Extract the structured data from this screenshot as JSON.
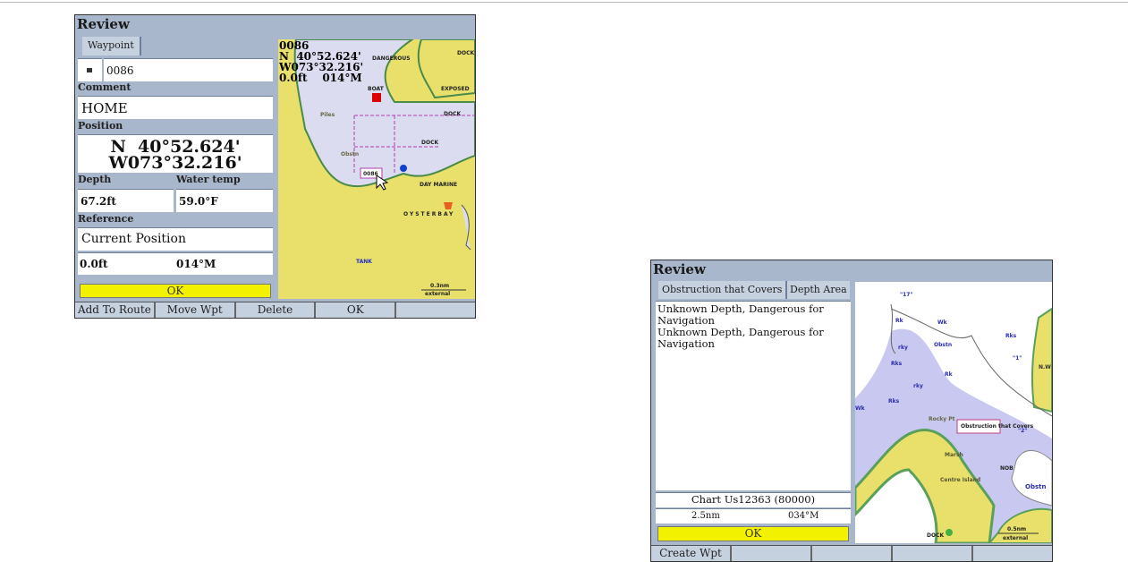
{
  "screen1": {
    "title": "Review",
    "tab": "Waypoint",
    "waypoint_name": "0086",
    "comment_label": "Comment",
    "comment": "HOME",
    "position_label": "Position",
    "lat": "N  40°52.624'",
    "lon": "W073°32.216'",
    "depth_label": "Depth",
    "depth": "67.2ft",
    "water_temp_label": "Water temp",
    "water_temp": "59.0°F",
    "reference_label": "Reference",
    "reference": "Current Position",
    "distance": "0.0ft",
    "bearing": "014°M",
    "ok": "OK",
    "softkeys": [
      "Add To Route",
      "Move Wpt",
      "Delete",
      "OK",
      ""
    ],
    "map": {
      "name": "0086",
      "lat": "N  40°52.624'",
      "lon": "W073°32.216'",
      "dist": "0.0ft",
      "bearing": "014°M",
      "labels": [
        "DANGEROUS",
        "DOCK",
        "EXPOSED",
        "BOAT",
        "Piles",
        "DOCK",
        "DOCK",
        "Obstn",
        "0086",
        "DAY MARINE",
        "OYSTERBAY",
        "TANK"
      ],
      "scale": "0.3nm",
      "scale_sub": "external"
    }
  },
  "screen2": {
    "title": "Review",
    "tabs": [
      "Obstruction that Covers",
      "Depth Area"
    ],
    "description": [
      "Unknown Depth, Dangerous for Navigation",
      "Unknown Depth, Dangerous for Navigation"
    ],
    "chart": "Chart Us12363 (80000)",
    "distance": "2.5nm",
    "bearing": "034°M",
    "ok": "OK",
    "softkeys": [
      "Create Wpt",
      "",
      "",
      "",
      ""
    ],
    "map": {
      "callout": "Obstruction that Covers",
      "labels": [
        "\"17\"",
        "Rk",
        "Wk",
        "Obstn",
        "rky",
        "Rks",
        "Rk",
        "rky",
        "Rks",
        "Rocky Pt",
        "Wk",
        "Marsh",
        "Centre Island",
        "NOB",
        "Obstn",
        "DOCK",
        "Rks",
        "\"1\"",
        "N.W",
        "\"2\""
      ],
      "scale": "0.5nm",
      "scale_sub": "external"
    }
  }
}
